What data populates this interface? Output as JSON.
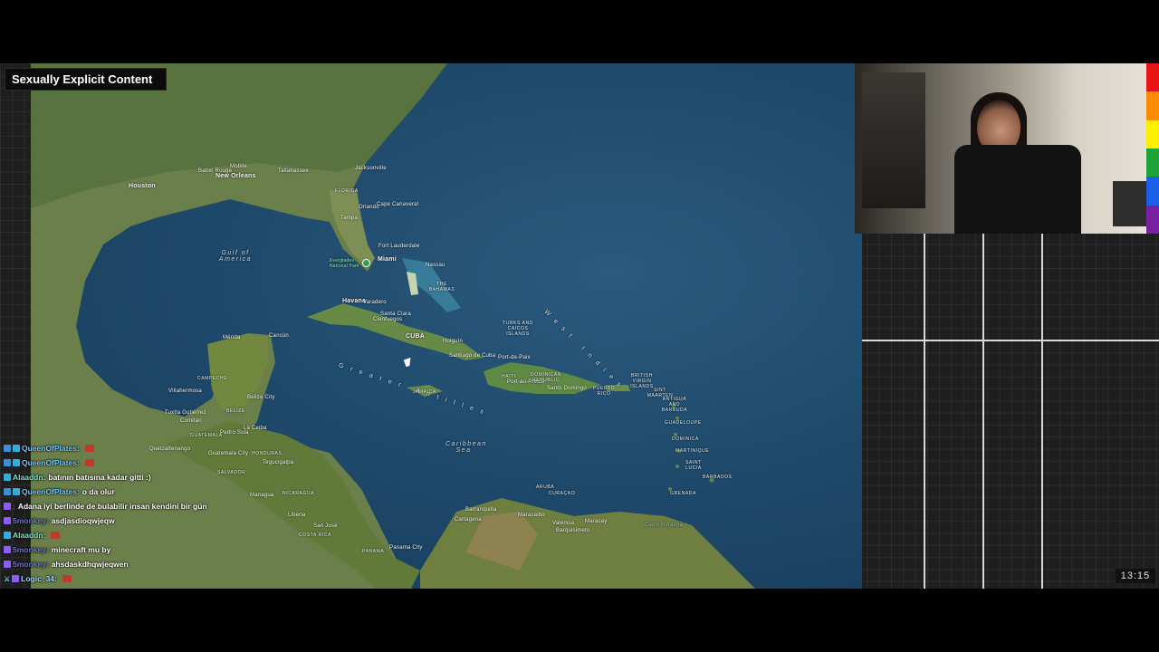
{
  "content_label": "Sexually Explicit Content",
  "clock": "13:15",
  "rainbow_colors": [
    "#e81416",
    "#ff8c00",
    "#fff000",
    "#1ea338",
    "#1d5fe8",
    "#7a1fa2"
  ],
  "map_labels": {
    "houston": "Houston",
    "baton_rouge": "Baton Rouge",
    "mobile": "Mobile",
    "new_orleans": "New Orleans",
    "tallahassee": "Tallahassee",
    "jacksonville": "Jacksonville",
    "florida": "FLORIDA",
    "orlando": "Orlando",
    "cape_canaveral": "Cape Canaveral",
    "tampa": "Tampa",
    "gulf": "Gulf of America",
    "fort_lauderdale": "Fort Lauderdale",
    "miami": "Miami",
    "everglades": "Everglades National Park",
    "nassau": "Nassau",
    "bahamas": "THE BAHAMAS",
    "havana": "Havana",
    "varadero": "Varadero",
    "santa_clara": "Santa Clara",
    "cienfuegos": "Cienfuegos",
    "cuba": "CUBA",
    "holguin": "Holguín",
    "santiago": "Santiago de Cuba",
    "port_de_paix": "Port-de-Paix",
    "turks": "TURKS AND CAICOS ISLANDS",
    "west_indies": "West Indies",
    "merida": "Mérida",
    "cancun": "Cancún",
    "campeche": "CAMPECHE",
    "villahermosa": "Villahermosa",
    "belize_city": "Belize City",
    "belize": "BELIZE",
    "tuxtla": "Tuxtla Gutiérrez",
    "comitan": "Comitán",
    "guatemala_region": "GUATEMALA",
    "la_ceiba": "La Ceiba",
    "pedro_sula": "Pedro Sula",
    "quetzaltenango": "Quetzaltenango",
    "guatemala_city": "Guatemala City",
    "honduras": "HONDURAS",
    "tegucigalpa": "Tegucigalpa",
    "salvador": "SALVADOR",
    "managua": "Managua",
    "nicaragua": "NICARAGUA",
    "liberia": "Liberia",
    "san_jose": "San José",
    "costa_rica": "COSTA RICA",
    "panama": "PANAMA",
    "panama_city": "Panama City",
    "jamaica": "JAMAICA",
    "greater_antilles": "Greater Antilles",
    "haiti": "HAITI",
    "port_au_prince": "Port-au-Prince",
    "dominican": "DOMINICAN REPUBLIC",
    "santo_domingo": "Santo Domingo",
    "puerto_rico": "PUERTO RICO",
    "bvi": "BRITISH VIRGIN ISLANDS",
    "sint_maarten": "SINT MAARTEN",
    "antigua": "ANTIGUA AND BARBUDA",
    "guadeloupe": "GUADELOUPE",
    "dominica": "DOMINICA",
    "martinique": "MARTINIQUE",
    "saint_lucia": "SAINT LUCIA",
    "barbados": "BARBADOS",
    "grenada": "GRENADA",
    "caribbean": "Caribbean Sea",
    "aruba": "ARUBA",
    "curacao": "CURAÇAO",
    "barranquilla": "Barranquilla",
    "cartagena": "Cartagena",
    "maracaibo": "Maracaibo",
    "valencia": "Valencia",
    "maracay": "Maracay",
    "barquisimeto": "Barquisimeto",
    "cerro": "Cerro Roraima"
  },
  "chat": [
    {
      "badges": [
        "mod",
        "sub"
      ],
      "user": "QueenOfPlates",
      "user_color": "#6ec6ff",
      "message": "",
      "emote": true
    },
    {
      "badges": [
        "mod",
        "sub"
      ],
      "user": "QueenOfPlates",
      "user_color": "#6ec6ff",
      "message": "",
      "emote": true
    },
    {
      "badges": [
        "sub"
      ],
      "user": "Alaaddn",
      "user_color": "#7fe3c4",
      "message": "batının batısına kadar gitti :)",
      "emote": false
    },
    {
      "badges": [
        "mod",
        "sub"
      ],
      "user": "QueenOfPlates",
      "user_color": "#6ec6ff",
      "message": "o da olur",
      "emote": false
    },
    {
      "badges": [
        "vip"
      ],
      "user": "",
      "user_color": "#d63a6a",
      "message": "Adana iyi berlinde de bulabilir insan kendini bir gün",
      "emote": false
    },
    {
      "badges": [
        "vip"
      ],
      "user": "5monkey",
      "user_color": "#6b78c9",
      "message": "asdjasdioqwjeqw",
      "emote": false
    },
    {
      "badges": [
        "sub"
      ],
      "user": "Alaaddn",
      "user_color": "#7fe3c4",
      "message": "",
      "emote": true
    },
    {
      "badges": [
        "vip"
      ],
      "user": "5monkey",
      "user_color": "#6b78c9",
      "message": "minecraft mu by",
      "emote": false
    },
    {
      "badges": [
        "vip"
      ],
      "user": "5monkey",
      "user_color": "#6b78c9",
      "message": "ahsdaskdhqwjeqwen",
      "emote": false
    },
    {
      "badges": [
        "sword",
        "vip"
      ],
      "user": "Logic_34",
      "user_color": "#9fd8ff",
      "message": "",
      "emote": true
    }
  ]
}
